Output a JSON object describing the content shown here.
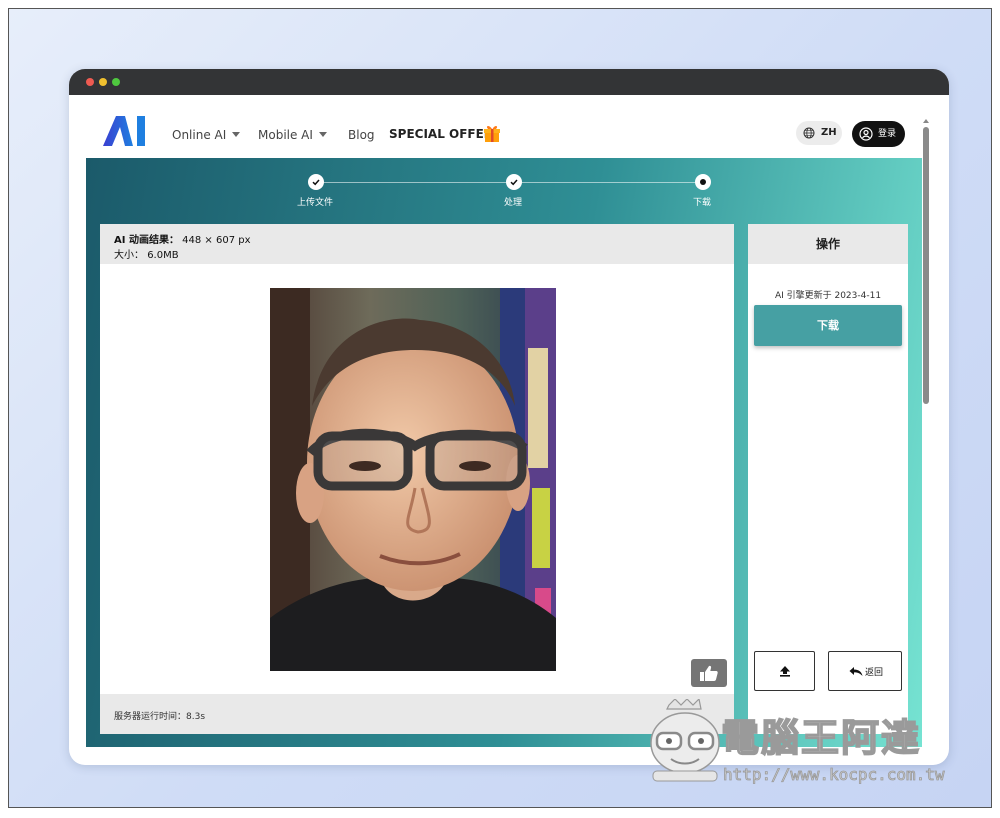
{
  "nav": {
    "online_ai": "Online AI",
    "mobile_ai": "Mobile AI",
    "blog": "Blog",
    "special_offer": "SPECIAL OFFER",
    "lang": "ZH",
    "login": "登录"
  },
  "steps": [
    {
      "label": "上传文件",
      "state": "done"
    },
    {
      "label": "处理",
      "state": "done"
    },
    {
      "label": "下载",
      "state": "current"
    }
  ],
  "result": {
    "title_label": "AI 动画结果：",
    "dimensions": "448 × 607 px",
    "size_label": "大小：",
    "size_value": "6.0MB",
    "server_time": "服务器运行时间：8.3s"
  },
  "ops": {
    "header": "操作",
    "engine_updated": "AI 引擎更新于 2023-4-11",
    "download": "下载",
    "back": "返回"
  },
  "watermark": {
    "title": "電腦王阿達",
    "url": "http://www.kocpc.com.tw"
  },
  "colors": {
    "accent": "#46a0a3",
    "hero_start": "#1b5a6a",
    "hero_end": "#76e3d2"
  }
}
